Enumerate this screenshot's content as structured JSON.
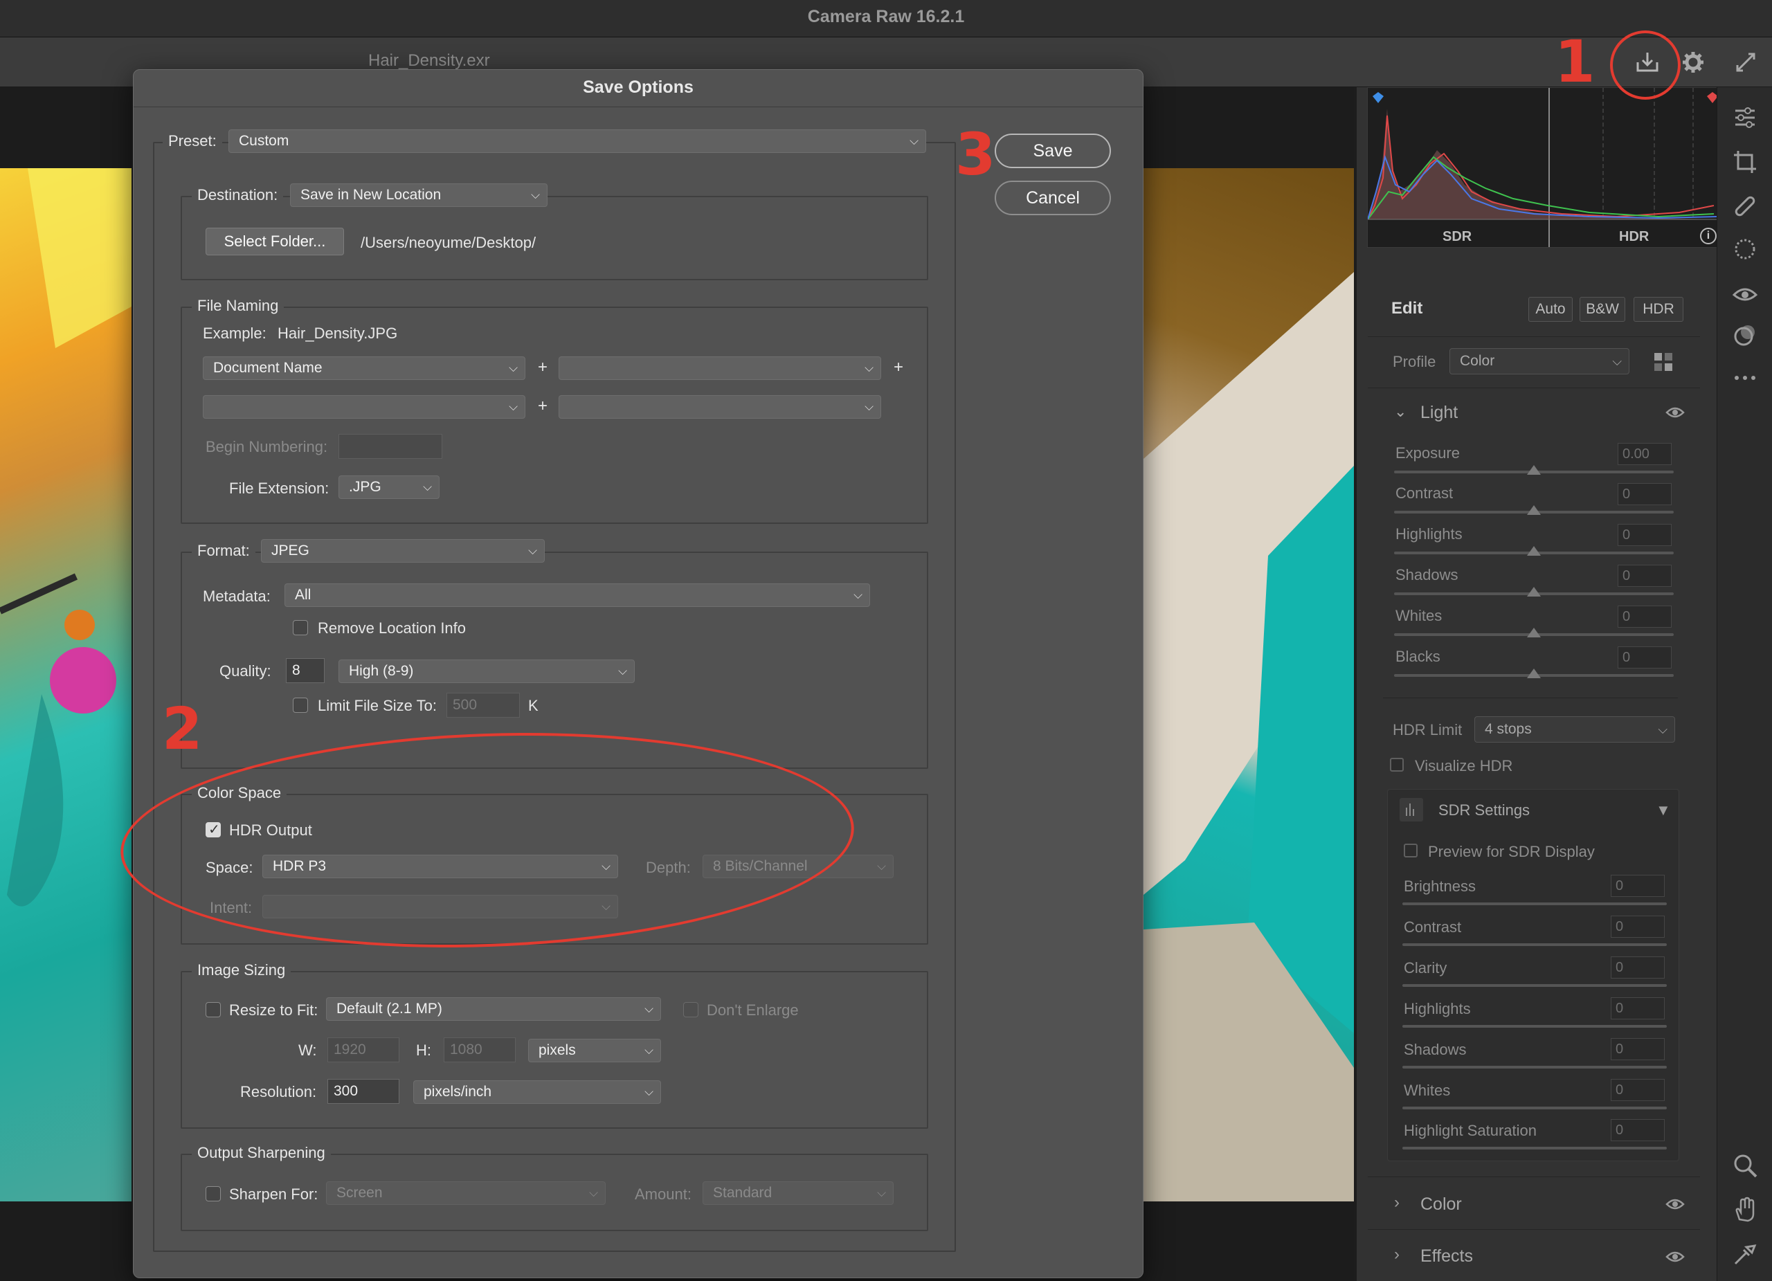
{
  "app": {
    "window_title": "Camera Raw 16.2.1",
    "file_name": "Hair_Density.exr"
  },
  "annotations": {
    "step1": "1",
    "step2": "2",
    "step3": "3",
    "color": "#e33b30"
  },
  "dialog": {
    "title": "Save Options",
    "preset_label": "Preset:",
    "preset_value": "Custom",
    "save_button": "Save",
    "cancel_button": "Cancel",
    "destination": {
      "label": "Destination:",
      "value": "Save in New Location",
      "select_folder_button": "Select Folder...",
      "path": "/Users/neoyume/Desktop/"
    },
    "file_naming": {
      "title": "File Naming",
      "example_label": "Example:",
      "example_value": "Hair_Density.JPG",
      "field1": "Document Name",
      "field2": "",
      "field3": "",
      "field4": "",
      "plus": "+",
      "begin_numbering_label": "Begin Numbering:",
      "begin_numbering_value": "",
      "file_extension_label": "File Extension:",
      "file_extension_value": ".JPG"
    },
    "format": {
      "label": "Format:",
      "value": "JPEG",
      "metadata_label": "Metadata:",
      "metadata_value": "All",
      "remove_location_label": "Remove Location Info",
      "remove_location_checked": false,
      "quality_label": "Quality:",
      "quality_value": "8",
      "quality_preset": "High  (8-9)",
      "limit_size_label": "Limit File Size To:",
      "limit_size_value": "500",
      "limit_size_unit": "K",
      "limit_size_checked": false
    },
    "color_space": {
      "title": "Color Space",
      "hdr_output_label": "HDR Output",
      "hdr_output_checked": true,
      "space_label": "Space:",
      "space_value": "HDR P3",
      "depth_label": "Depth:",
      "depth_value": "8 Bits/Channel",
      "intent_label": "Intent:",
      "intent_value": ""
    },
    "image_sizing": {
      "title": "Image Sizing",
      "resize_label": "Resize to Fit:",
      "resize_checked": false,
      "resize_value": "Default  (2.1 MP)",
      "dont_enlarge_label": "Don't Enlarge",
      "w_label": "W:",
      "w_value": "1920",
      "h_label": "H:",
      "h_value": "1080",
      "unit_value": "pixels",
      "resolution_label": "Resolution:",
      "resolution_value": "300",
      "resolution_unit": "pixels/inch"
    },
    "output_sharpening": {
      "title": "Output Sharpening",
      "sharpen_label": "Sharpen For:",
      "sharpen_checked": false,
      "sharpen_value": "Screen",
      "amount_label": "Amount:",
      "amount_value": "Standard"
    }
  },
  "histogram": {
    "sdr_label": "SDR",
    "hdr_label": "HDR"
  },
  "edit_panel": {
    "title": "Edit",
    "auto": "Auto",
    "bw": "B&W",
    "hdr": "HDR",
    "profile_label": "Profile",
    "profile_value": "Color",
    "light_section": "Light",
    "light_sliders": [
      {
        "label": "Exposure",
        "value": "0.00"
      },
      {
        "label": "Contrast",
        "value": "0"
      },
      {
        "label": "Highlights",
        "value": "0"
      },
      {
        "label": "Shadows",
        "value": "0"
      },
      {
        "label": "Whites",
        "value": "0"
      },
      {
        "label": "Blacks",
        "value": "0"
      }
    ],
    "hdr_limit_label": "HDR Limit",
    "hdr_limit_value": "4 stops",
    "visualize_hdr": "Visualize HDR",
    "sdr_settings": "SDR Settings",
    "preview_sdr": "Preview for SDR Display",
    "sdr_sliders": [
      {
        "label": "Brightness",
        "value": "0"
      },
      {
        "label": "Contrast",
        "value": "0"
      },
      {
        "label": "Clarity",
        "value": "0"
      },
      {
        "label": "Highlights",
        "value": "0"
      },
      {
        "label": "Shadows",
        "value": "0"
      },
      {
        "label": "Whites",
        "value": "0"
      },
      {
        "label": "Highlight Saturation",
        "value": "0"
      }
    ],
    "color_section": "Color",
    "effects_section": "Effects"
  }
}
